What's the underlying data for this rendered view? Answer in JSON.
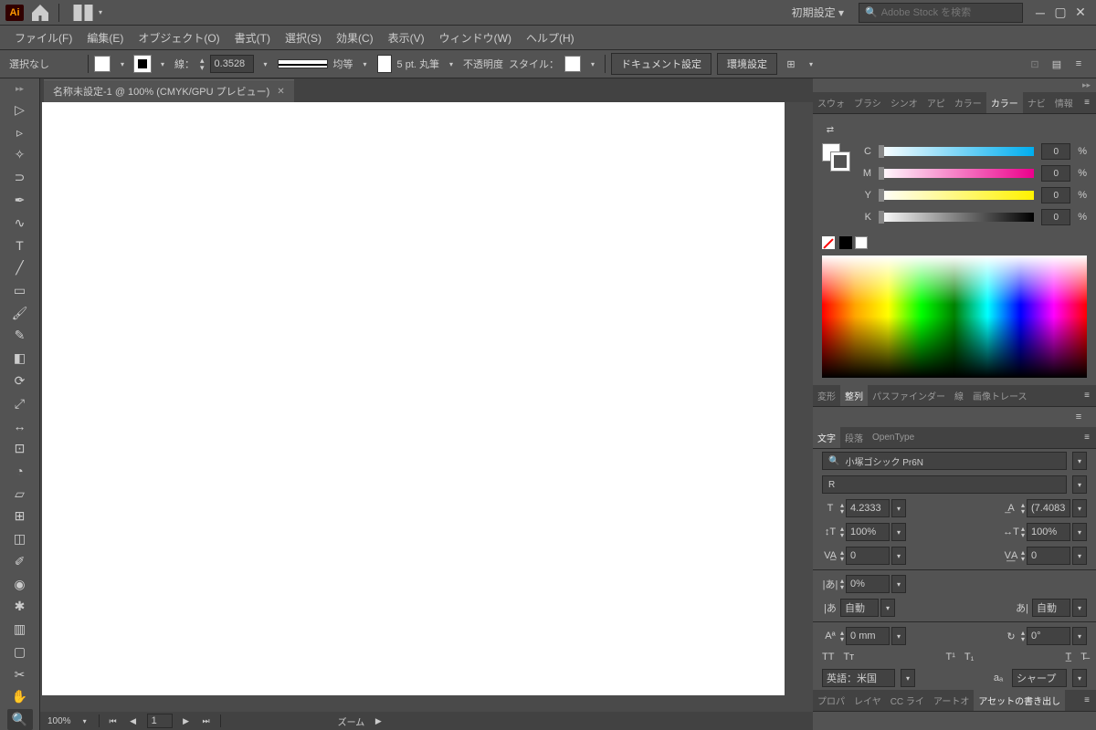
{
  "topbar": {
    "workspace": "初期設定",
    "search_placeholder": "Adobe Stock を検索"
  },
  "menubar": [
    "ファイル(F)",
    "編集(E)",
    "オブジェクト(O)",
    "書式(T)",
    "選択(S)",
    "効果(C)",
    "表示(V)",
    "ウィンドウ(W)",
    "ヘルプ(H)"
  ],
  "controlbar": {
    "selection": "選択なし",
    "stroke_label": "線：",
    "stroke_weight": "0.3528",
    "uniform": "均等",
    "brush": "5 pt. 丸筆",
    "opacity": "不透明度",
    "style": "スタイル：",
    "doc_setup": "ドキュメント設定",
    "prefs": "環境設定"
  },
  "doc_tab": "名称未設定-1 @ 100% (CMYK/GPU プレビュー)",
  "status": {
    "zoom": "100%",
    "page": "1",
    "mode": "ズーム"
  },
  "panel_tabs1": [
    "スウォ",
    "ブラシ",
    "シンオ",
    "アピ",
    "カラー",
    "カラー",
    "ナビ",
    "情報"
  ],
  "panel_tabs1_active": 5,
  "color": {
    "c": {
      "label": "C",
      "value": "0",
      "pct": "%"
    },
    "m": {
      "label": "M",
      "value": "0",
      "pct": "%"
    },
    "y": {
      "label": "Y",
      "value": "0",
      "pct": "%"
    },
    "k": {
      "label": "K",
      "value": "0",
      "pct": "%"
    }
  },
  "panel_tabs2": [
    "変形",
    "整列",
    "パスファインダー",
    "線",
    "画像トレース"
  ],
  "panel_tabs2_active": 1,
  "panel_tabs3": [
    "文字",
    "段落",
    "OpenType"
  ],
  "panel_tabs3_active": 0,
  "character": {
    "font": "小塚ゴシック Pr6N",
    "style": "R",
    "size": "4.2333",
    "leading": "(7.4083",
    "hscale": "100%",
    "vscale": "100%",
    "kerning": "0",
    "tracking": "0",
    "baseline_pct": "0%",
    "auto1": "自動",
    "auto2": "自動",
    "baseline_shift": "0 mm",
    "rotation": "0°",
    "language": "英語：米国",
    "aa": "シャープ"
  },
  "panel_tabs4": [
    "プロパ",
    "レイヤ",
    "CC ライ",
    "アートオ",
    "アセットの書き出し"
  ]
}
